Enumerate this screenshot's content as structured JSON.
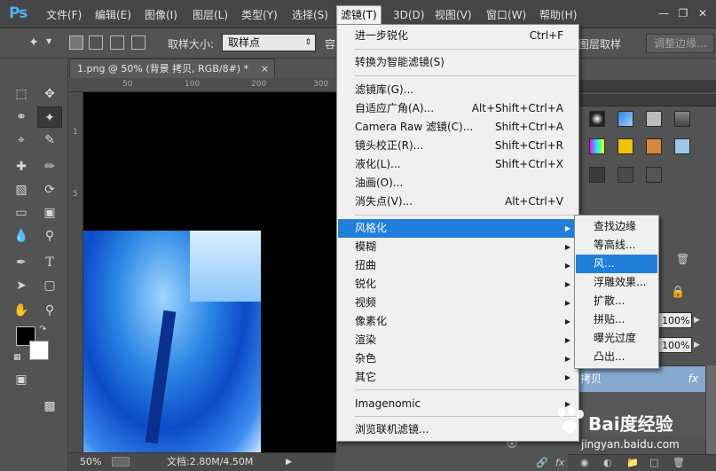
{
  "app": {
    "logo": "Ps"
  },
  "menubar": {
    "items": [
      "文件(F)",
      "编辑(E)",
      "图像(I)",
      "图层(L)",
      "类型(Y)",
      "选择(S)",
      "滤镜(T)",
      "3D(D)",
      "视图(V)",
      "窗口(W)",
      "帮助(H)"
    ],
    "active": "滤镜(T)"
  },
  "options": {
    "sample_size_label": "取样大小:",
    "sample_size_value": "取样点",
    "tolerance_label_fragment": "容",
    "sample_layers_fragment": "图层取样",
    "refine_edge_button": "调整边缘..."
  },
  "document": {
    "tab_title": "1.png @ 50% (背景 拷贝, RGB/8#) *",
    "close_glyph": "×",
    "ruler_h": [
      "50",
      "100",
      "150",
      "200",
      "250",
      "300",
      "350"
    ],
    "ruler_v": [
      "1",
      "5",
      "0",
      "1",
      "0",
      "0"
    ]
  },
  "status": {
    "zoom": "50%",
    "doc_info": "文档:2.80M/4.50M"
  },
  "filter_menu": {
    "items": [
      {
        "label": "进一步锐化",
        "shortcut": "Ctrl+F"
      },
      {
        "label": "转换为智能滤镜(S)"
      },
      {
        "label": "滤镜库(G)..."
      },
      {
        "label": "自适应广角(A)...",
        "shortcut": "Alt+Shift+Ctrl+A"
      },
      {
        "label": "Camera Raw 滤镜(C)...",
        "shortcut": "Shift+Ctrl+A"
      },
      {
        "label": "镜头校正(R)...",
        "shortcut": "Shift+Ctrl+R"
      },
      {
        "label": "液化(L)...",
        "shortcut": "Shift+Ctrl+X"
      },
      {
        "label": "油画(O)..."
      },
      {
        "label": "消失点(V)...",
        "shortcut": "Alt+Ctrl+V"
      },
      {
        "label": "风格化",
        "submenu": true,
        "highlighted": true
      },
      {
        "label": "模糊",
        "submenu": true
      },
      {
        "label": "扭曲",
        "submenu": true
      },
      {
        "label": "锐化",
        "submenu": true
      },
      {
        "label": "视频",
        "submenu": true
      },
      {
        "label": "像素化",
        "submenu": true
      },
      {
        "label": "渲染",
        "submenu": true
      },
      {
        "label": "杂色",
        "submenu": true
      },
      {
        "label": "其它",
        "submenu": true
      },
      {
        "label": "Imagenomic",
        "submenu": true
      },
      {
        "label": "浏览联机滤镜..."
      }
    ]
  },
  "stylize_submenu": {
    "items": [
      "查找边缘",
      "等高线...",
      "风...",
      "浮雕效果...",
      "扩散...",
      "拼贴...",
      "曝光过度",
      "凸出..."
    ],
    "highlighted": "风..."
  },
  "layers": {
    "opacity": "100%",
    "fill": "100%",
    "active_layer_name": "拷贝",
    "fx_label": "fx",
    "row_fragment": "f"
  },
  "watermark": {
    "brand": "Bai度经验",
    "url": "jingyan.baidu.com"
  },
  "colors": {
    "foreground": "#000000",
    "background": "#ffffff",
    "highlight": "#1f7fdb"
  }
}
